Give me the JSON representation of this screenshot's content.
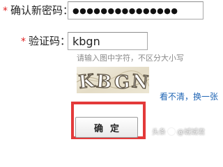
{
  "form": {
    "required_mark": "*",
    "confirm_password": {
      "label": "确认新密码：",
      "value": "●●●●●●●●●●●●●●●"
    },
    "verify_code": {
      "label": "验证码：",
      "value": "kbgn",
      "hint": "请输入图中字符，不区分大小写"
    },
    "captcha": {
      "characters": [
        "K",
        "B",
        "G",
        "N"
      ]
    },
    "refresh_link": "看不清，换一张",
    "submit_label": "确定"
  },
  "colors": {
    "required": "#e02020",
    "link": "#1e64b4",
    "highlight_box": "#e33a3a"
  },
  "watermark": {
    "prefix": "头条",
    "account": "@城城君"
  }
}
